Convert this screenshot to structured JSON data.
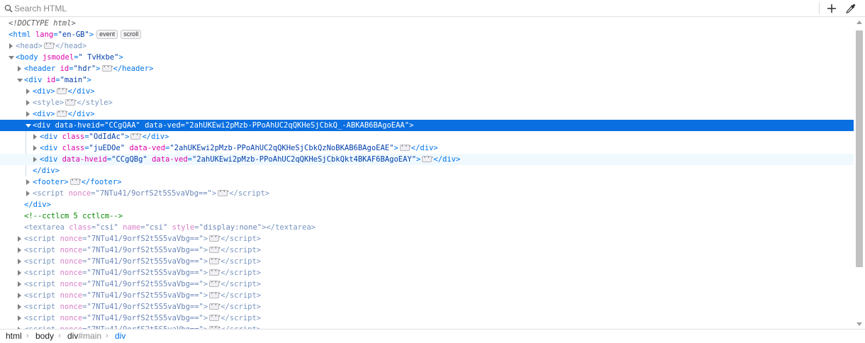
{
  "toolbar": {
    "search_placeholder": "Search HTML",
    "icons": {
      "search": "search-icon",
      "add": "plus-icon",
      "picker": "eyedropper-icon"
    }
  },
  "colors": {
    "tag": "#0074e8",
    "attribute": "#dd00a9",
    "value": "#003eaa",
    "comment": "#058b00",
    "selection": "#0a6fe0"
  },
  "tree": {
    "doctype": "<!DOCTYPE html>",
    "html_open": "<html lang=\"en-GB\">",
    "html_badges": [
      "event",
      "scroll"
    ],
    "head": "<head>",
    "head_close": "</head>",
    "body_open": "<body jsmodel=\" TvHxbe\">",
    "header": "<header id=\"hdr\">",
    "header_close": "</header>",
    "main_open": "<div id=\"main\">",
    "div_1": "<div>",
    "div_close": "</div>",
    "style_open": "<style>",
    "style_close": "</style>",
    "div_3": "<div>",
    "selected_div": {
      "tag_open": "<div",
      "attr1_name": "data-hveid",
      "attr1_value": "\"CCgQAA\"",
      "attr2_name": "data-ved",
      "attr2_value": "\"2ahUKEwi2pMzb-PPoAhUC2qQKHeSjCbkQ_-ABKAB6BAgoEAA\"",
      "tag_end": ">"
    },
    "child_1": {
      "attr_name": "class",
      "attr_value": "\"OdIdAc\""
    },
    "child_2": {
      "attr1_name": "class",
      "attr1_value": "\"juEDOe\"",
      "attr2_name": "data-ved",
      "attr2_value": "\"2ahUKEwi2pMzb-PPoAhUC2qQKHeSjCbkQzNoBKAB6BAgoEAE\""
    },
    "child_3": {
      "attr1_name": "data-hveid",
      "attr1_value": "\"CCgQBg\"",
      "attr2_name": "data-ved",
      "attr2_value": "\"2ahUKEwi2pMzb-PPoAhUC2qQKHeSjCbkQkt4BKAF6BAgoEAY\""
    },
    "footer": "<footer>",
    "footer_close": "</footer>",
    "script_nonce_value": "\"7NTu41/9orfS2t5S5vaVbg==\"",
    "comment": "<!--cctlcm 5 cctlcm-->",
    "textarea": {
      "class_value": "\"csi\"",
      "name_value": "\"csi\"",
      "style_value": "\"display:none\""
    },
    "script_rows_count_visible": 9
  },
  "breadcrumb": [
    {
      "label": "html"
    },
    {
      "label": "body"
    },
    {
      "label": "div",
      "suffix": "#main"
    },
    {
      "label": "div",
      "current": true
    }
  ]
}
